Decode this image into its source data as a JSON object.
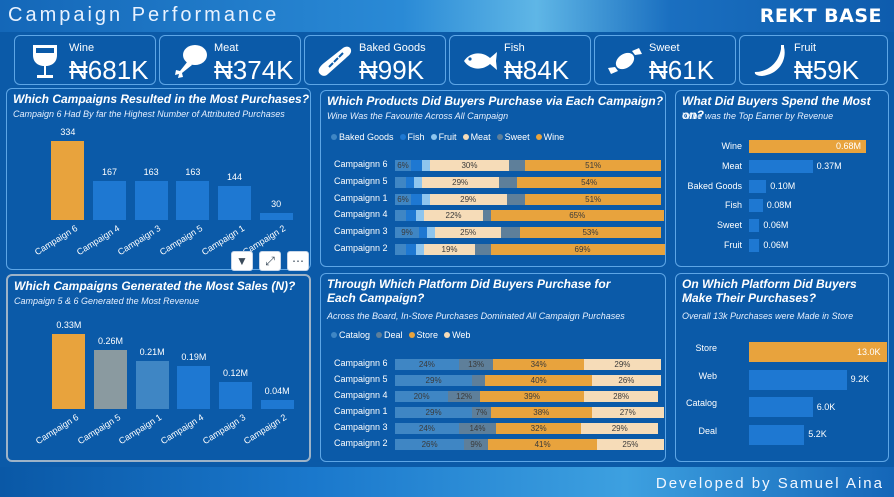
{
  "header": {
    "title": "Campaign Performance",
    "brand": "REKT BASE"
  },
  "footer": {
    "credit": "Developed by Samuel Aina"
  },
  "kpis": [
    {
      "label": "Wine",
      "value": "₦681K",
      "icon": "wine-glass-icon"
    },
    {
      "label": "Meat",
      "value": "₦374K",
      "icon": "drumstick-icon"
    },
    {
      "label": "Baked Goods",
      "value": "₦99K",
      "icon": "bread-icon"
    },
    {
      "label": "Fish",
      "value": "₦84K",
      "icon": "fish-icon"
    },
    {
      "label": "Sweet",
      "value": "₦61K",
      "icon": "candy-icon"
    },
    {
      "label": "Fruit",
      "value": "₦59K",
      "icon": "banana-icon"
    }
  ],
  "visual_toolbar": {
    "filter": "filter-icon",
    "focus": "focus-mode-icon",
    "more": "more-options-icon"
  },
  "colors": {
    "orange": "#e8a33d",
    "blue": "#1e78d2",
    "gray": "#8a9aa0",
    "steel": "#3f86c4",
    "lightblue": "#8ec5ee",
    "cream": "#f6dcb8",
    "darkslate": "#5e7f9a",
    "darkblue": "#0f4f93"
  },
  "chart_data": [
    {
      "id": "purchases",
      "type": "bar",
      "title": "Which Campaigns Resulted in the Most Purchases?",
      "subtitle": "Campaign 6 Had By far the Highest Number of Attributed Purchases",
      "categories": [
        "Campaign 6",
        "Campaign 4",
        "Campaign 3",
        "Campaign 5",
        "Campaign 1",
        "Campaign 2"
      ],
      "values": [
        334,
        167,
        163,
        163,
        144,
        30
      ],
      "labels": [
        "334",
        "167",
        "163",
        "163",
        "144",
        "30"
      ],
      "colors": [
        "#e8a33d",
        "#1e78d2",
        "#1e78d2",
        "#1e78d2",
        "#1e78d2",
        "#1e78d2"
      ]
    },
    {
      "id": "sales",
      "type": "bar",
      "title": "Which Campaigns Generated the Most Sales (N)?",
      "subtitle": "Campaign 5 & 6 Generated the Most Revenue",
      "categories": [
        "Campaign 6",
        "Campaign 5",
        "Campaign 1",
        "Campaign 4",
        "Campaign 3",
        "Campaign 2"
      ],
      "values": [
        0.33,
        0.26,
        0.21,
        0.19,
        0.12,
        0.04
      ],
      "labels": [
        "0.33M",
        "0.26M",
        "0.21M",
        "0.19M",
        "0.12M",
        "0.04M"
      ],
      "colors": [
        "#e8a33d",
        "#8a9aa0",
        "#3f86c4",
        "#1e78d2",
        "#1e78d2",
        "#1e78d2"
      ]
    },
    {
      "id": "products",
      "type": "bar",
      "stacked": "100%",
      "title": "Which Products Did Buyers Purchase via Each Campaign?",
      "subtitle": "Wine Was the Favourite Across All Campaign",
      "legend": [
        "Baked Goods",
        "Fish",
        "Fruit",
        "Meat",
        "Sweet",
        "Wine"
      ],
      "legend_colors": [
        "#3f86c4",
        "#1e78d2",
        "#8ec5ee",
        "#f6dcb8",
        "#5e7f9a",
        "#e8a33d"
      ],
      "categories": [
        "Campaignn 6",
        "Campaignn 5",
        "Campaignn 1",
        "Campaignn 4",
        "Campaignn 3",
        "Campaignn 2"
      ],
      "series": [
        {
          "name": "Baked Goods",
          "values": [
            6,
            4,
            6,
            4,
            9,
            4
          ]
        },
        {
          "name": "Fish",
          "values": [
            4,
            3,
            4,
            4,
            3,
            4
          ]
        },
        {
          "name": "Fruit",
          "values": [
            3,
            3,
            3,
            3,
            3,
            3
          ]
        },
        {
          "name": "Meat",
          "values": [
            30,
            29,
            29,
            22,
            25,
            19
          ]
        },
        {
          "name": "Sweet",
          "values": [
            6,
            7,
            7,
            3,
            7,
            6
          ]
        },
        {
          "name": "Wine",
          "values": [
            51,
            54,
            51,
            65,
            53,
            69
          ]
        }
      ],
      "labels": [
        {
          "row": 0,
          "series": "Baked Goods",
          "text": "6%"
        },
        {
          "row": 0,
          "series": "Meat",
          "text": "30%"
        },
        {
          "row": 0,
          "series": "Wine",
          "text": "51%"
        },
        {
          "row": 1,
          "series": "Meat",
          "text": "29%"
        },
        {
          "row": 1,
          "series": "Wine",
          "text": "54%"
        },
        {
          "row": 2,
          "series": "Baked Goods",
          "text": "6%"
        },
        {
          "row": 2,
          "series": "Meat",
          "text": "29%"
        },
        {
          "row": 2,
          "series": "Wine",
          "text": "51%"
        },
        {
          "row": 3,
          "series": "Meat",
          "text": "22%"
        },
        {
          "row": 3,
          "series": "Wine",
          "text": "65%"
        },
        {
          "row": 4,
          "series": "Baked Goods",
          "text": "9%"
        },
        {
          "row": 4,
          "series": "Meat",
          "text": "25%"
        },
        {
          "row": 4,
          "series": "Wine",
          "text": "53%"
        },
        {
          "row": 5,
          "series": "Meat",
          "text": "19%"
        },
        {
          "row": 5,
          "series": "Wine",
          "text": "69%"
        }
      ]
    },
    {
      "id": "spend",
      "type": "bar",
      "orientation": "horizontal",
      "title": "What Did Buyers Spend the Most on?",
      "subtitle": "Wine was the Top Earner by Revenue",
      "categories": [
        "Wine",
        "Meat",
        "Baked Goods",
        "Fish",
        "Sweet",
        "Fruit"
      ],
      "values": [
        0.68,
        0.37,
        0.1,
        0.08,
        0.06,
        0.06
      ],
      "labels": [
        "0.68M",
        "0.37M",
        "0.10M",
        "0.08M",
        "0.06M",
        "0.06M"
      ],
      "colors": [
        "#e8a33d",
        "#1e78d2",
        "#1e78d2",
        "#1e78d2",
        "#1e78d2",
        "#1e78d2"
      ]
    },
    {
      "id": "platform_campaign",
      "type": "bar",
      "stacked": "100%",
      "title": "Through Which Platform Did Buyers Purchase for Each Campaign?",
      "subtitle": "Across the Board, In-Store Purchases Dominated All Campaign Purchases",
      "legend": [
        "Catalog",
        "Deal",
        "Store",
        "Web"
      ],
      "legend_colors": [
        "#3f86c4",
        "#5e7f9a",
        "#e8a33d",
        "#f6dcb8"
      ],
      "categories": [
        "Campaignn 6",
        "Campaignn 5",
        "Campaignn 4",
        "Campaignn 1",
        "Campaignn 3",
        "Campaignn 2"
      ],
      "series": [
        {
          "name": "Catalog",
          "values": [
            24,
            29,
            20,
            29,
            24,
            26
          ]
        },
        {
          "name": "Deal",
          "values": [
            13,
            5,
            12,
            7,
            14,
            9
          ]
        },
        {
          "name": "Store",
          "values": [
            34,
            40,
            39,
            38,
            32,
            41
          ]
        },
        {
          "name": "Web",
          "values": [
            29,
            26,
            28,
            27,
            29,
            25
          ]
        }
      ],
      "labels": [
        [
          "24%",
          "13%",
          "34%",
          "29%"
        ],
        [
          "29%",
          "",
          "40%",
          "26%"
        ],
        [
          "20%",
          "12%",
          "39%",
          "28%"
        ],
        [
          "29%",
          "7%",
          "38%",
          "27%"
        ],
        [
          "24%",
          "14%",
          "32%",
          "29%"
        ],
        [
          "26%",
          "9%",
          "41%",
          "25%"
        ]
      ]
    },
    {
      "id": "platform",
      "type": "bar",
      "orientation": "horizontal",
      "title": "On Which Platform Did Buyers Make Their Purchases?",
      "subtitle": "Overall 13k Purchases were Made in Store",
      "categories": [
        "Store",
        "Web",
        "Catalog",
        "Deal"
      ],
      "values": [
        13.0,
        9.2,
        6.0,
        5.2
      ],
      "labels": [
        "13.0K",
        "9.2K",
        "6.0K",
        "5.2K"
      ],
      "colors": [
        "#e8a33d",
        "#1e78d2",
        "#1e78d2",
        "#1e78d2"
      ]
    }
  ]
}
